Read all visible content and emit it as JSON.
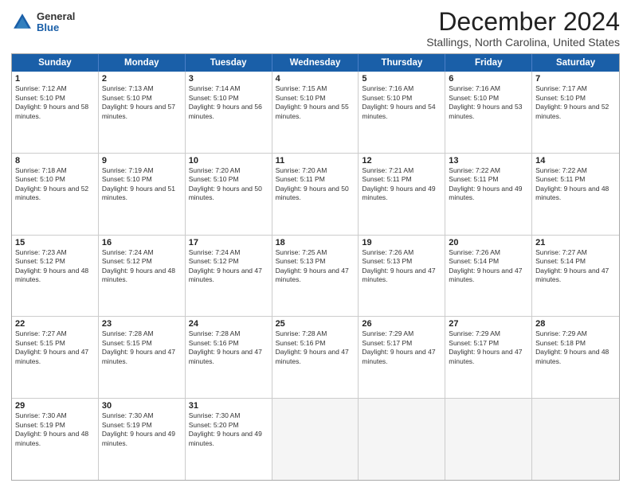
{
  "logo": {
    "general": "General",
    "blue": "Blue"
  },
  "title": "December 2024",
  "location": "Stallings, North Carolina, United States",
  "days_header": [
    "Sunday",
    "Monday",
    "Tuesday",
    "Wednesday",
    "Thursday",
    "Friday",
    "Saturday"
  ],
  "rows": [
    [
      {
        "day": "1",
        "sunrise": "Sunrise: 7:12 AM",
        "sunset": "Sunset: 5:10 PM",
        "daylight": "Daylight: 9 hours and 58 minutes."
      },
      {
        "day": "2",
        "sunrise": "Sunrise: 7:13 AM",
        "sunset": "Sunset: 5:10 PM",
        "daylight": "Daylight: 9 hours and 57 minutes."
      },
      {
        "day": "3",
        "sunrise": "Sunrise: 7:14 AM",
        "sunset": "Sunset: 5:10 PM",
        "daylight": "Daylight: 9 hours and 56 minutes."
      },
      {
        "day": "4",
        "sunrise": "Sunrise: 7:15 AM",
        "sunset": "Sunset: 5:10 PM",
        "daylight": "Daylight: 9 hours and 55 minutes."
      },
      {
        "day": "5",
        "sunrise": "Sunrise: 7:16 AM",
        "sunset": "Sunset: 5:10 PM",
        "daylight": "Daylight: 9 hours and 54 minutes."
      },
      {
        "day": "6",
        "sunrise": "Sunrise: 7:16 AM",
        "sunset": "Sunset: 5:10 PM",
        "daylight": "Daylight: 9 hours and 53 minutes."
      },
      {
        "day": "7",
        "sunrise": "Sunrise: 7:17 AM",
        "sunset": "Sunset: 5:10 PM",
        "daylight": "Daylight: 9 hours and 52 minutes."
      }
    ],
    [
      {
        "day": "8",
        "sunrise": "Sunrise: 7:18 AM",
        "sunset": "Sunset: 5:10 PM",
        "daylight": "Daylight: 9 hours and 52 minutes."
      },
      {
        "day": "9",
        "sunrise": "Sunrise: 7:19 AM",
        "sunset": "Sunset: 5:10 PM",
        "daylight": "Daylight: 9 hours and 51 minutes."
      },
      {
        "day": "10",
        "sunrise": "Sunrise: 7:20 AM",
        "sunset": "Sunset: 5:10 PM",
        "daylight": "Daylight: 9 hours and 50 minutes."
      },
      {
        "day": "11",
        "sunrise": "Sunrise: 7:20 AM",
        "sunset": "Sunset: 5:11 PM",
        "daylight": "Daylight: 9 hours and 50 minutes."
      },
      {
        "day": "12",
        "sunrise": "Sunrise: 7:21 AM",
        "sunset": "Sunset: 5:11 PM",
        "daylight": "Daylight: 9 hours and 49 minutes."
      },
      {
        "day": "13",
        "sunrise": "Sunrise: 7:22 AM",
        "sunset": "Sunset: 5:11 PM",
        "daylight": "Daylight: 9 hours and 49 minutes."
      },
      {
        "day": "14",
        "sunrise": "Sunrise: 7:22 AM",
        "sunset": "Sunset: 5:11 PM",
        "daylight": "Daylight: 9 hours and 48 minutes."
      }
    ],
    [
      {
        "day": "15",
        "sunrise": "Sunrise: 7:23 AM",
        "sunset": "Sunset: 5:12 PM",
        "daylight": "Daylight: 9 hours and 48 minutes."
      },
      {
        "day": "16",
        "sunrise": "Sunrise: 7:24 AM",
        "sunset": "Sunset: 5:12 PM",
        "daylight": "Daylight: 9 hours and 48 minutes."
      },
      {
        "day": "17",
        "sunrise": "Sunrise: 7:24 AM",
        "sunset": "Sunset: 5:12 PM",
        "daylight": "Daylight: 9 hours and 47 minutes."
      },
      {
        "day": "18",
        "sunrise": "Sunrise: 7:25 AM",
        "sunset": "Sunset: 5:13 PM",
        "daylight": "Daylight: 9 hours and 47 minutes."
      },
      {
        "day": "19",
        "sunrise": "Sunrise: 7:26 AM",
        "sunset": "Sunset: 5:13 PM",
        "daylight": "Daylight: 9 hours and 47 minutes."
      },
      {
        "day": "20",
        "sunrise": "Sunrise: 7:26 AM",
        "sunset": "Sunset: 5:14 PM",
        "daylight": "Daylight: 9 hours and 47 minutes."
      },
      {
        "day": "21",
        "sunrise": "Sunrise: 7:27 AM",
        "sunset": "Sunset: 5:14 PM",
        "daylight": "Daylight: 9 hours and 47 minutes."
      }
    ],
    [
      {
        "day": "22",
        "sunrise": "Sunrise: 7:27 AM",
        "sunset": "Sunset: 5:15 PM",
        "daylight": "Daylight: 9 hours and 47 minutes."
      },
      {
        "day": "23",
        "sunrise": "Sunrise: 7:28 AM",
        "sunset": "Sunset: 5:15 PM",
        "daylight": "Daylight: 9 hours and 47 minutes."
      },
      {
        "day": "24",
        "sunrise": "Sunrise: 7:28 AM",
        "sunset": "Sunset: 5:16 PM",
        "daylight": "Daylight: 9 hours and 47 minutes."
      },
      {
        "day": "25",
        "sunrise": "Sunrise: 7:28 AM",
        "sunset": "Sunset: 5:16 PM",
        "daylight": "Daylight: 9 hours and 47 minutes."
      },
      {
        "day": "26",
        "sunrise": "Sunrise: 7:29 AM",
        "sunset": "Sunset: 5:17 PM",
        "daylight": "Daylight: 9 hours and 47 minutes."
      },
      {
        "day": "27",
        "sunrise": "Sunrise: 7:29 AM",
        "sunset": "Sunset: 5:17 PM",
        "daylight": "Daylight: 9 hours and 47 minutes."
      },
      {
        "day": "28",
        "sunrise": "Sunrise: 7:29 AM",
        "sunset": "Sunset: 5:18 PM",
        "daylight": "Daylight: 9 hours and 48 minutes."
      }
    ],
    [
      {
        "day": "29",
        "sunrise": "Sunrise: 7:30 AM",
        "sunset": "Sunset: 5:19 PM",
        "daylight": "Daylight: 9 hours and 48 minutes."
      },
      {
        "day": "30",
        "sunrise": "Sunrise: 7:30 AM",
        "sunset": "Sunset: 5:19 PM",
        "daylight": "Daylight: 9 hours and 49 minutes."
      },
      {
        "day": "31",
        "sunrise": "Sunrise: 7:30 AM",
        "sunset": "Sunset: 5:20 PM",
        "daylight": "Daylight: 9 hours and 49 minutes."
      },
      null,
      null,
      null,
      null
    ]
  ]
}
